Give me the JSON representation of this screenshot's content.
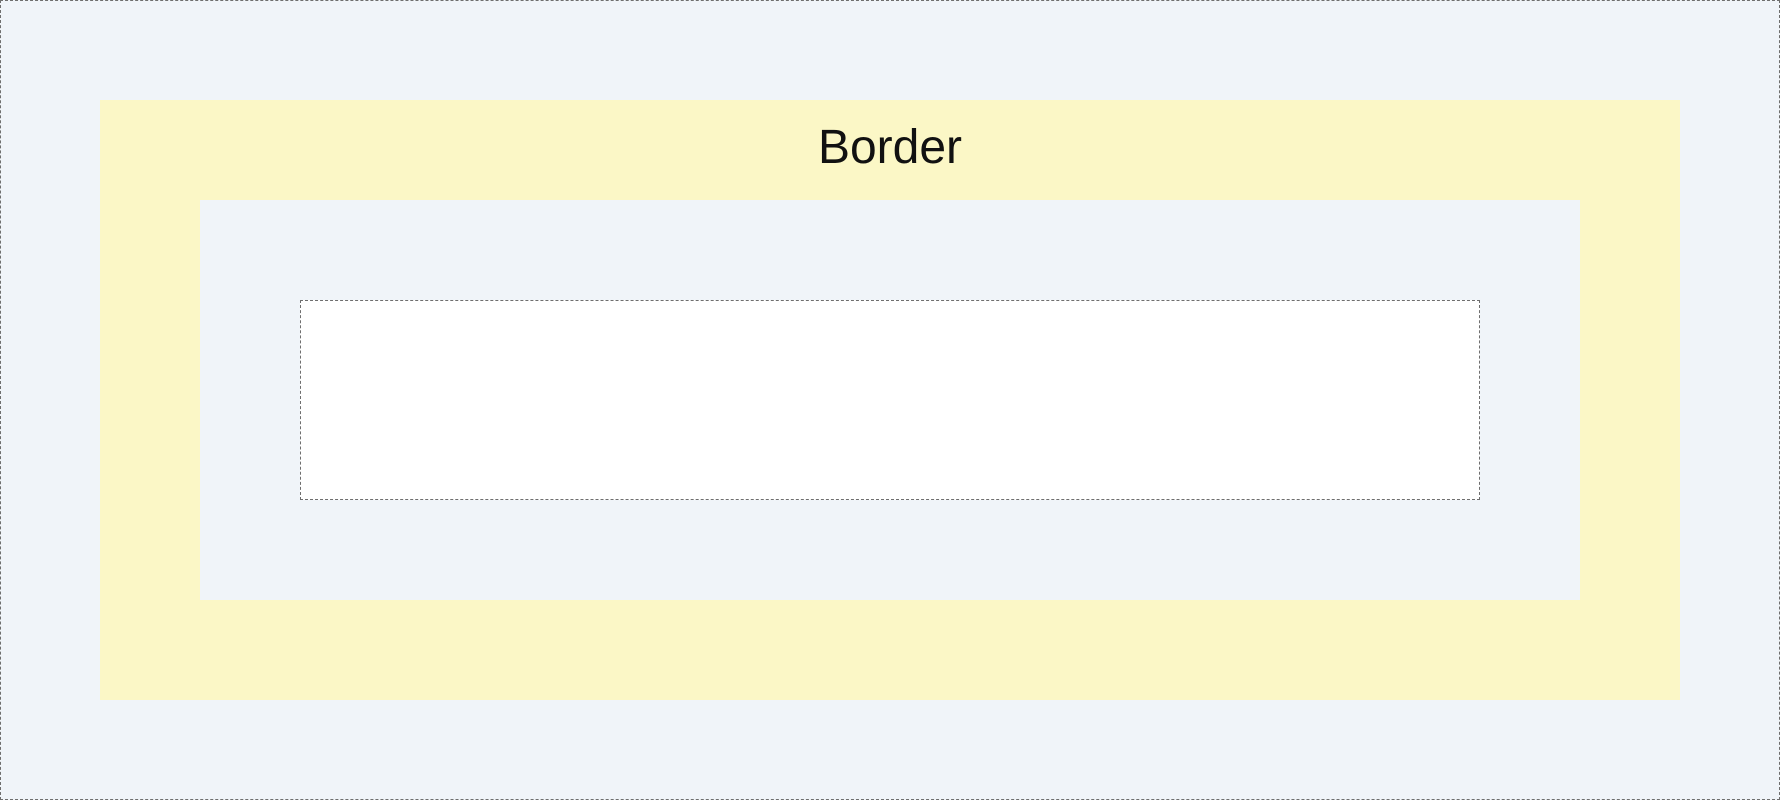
{
  "diagram": {
    "border_label": "Border"
  },
  "colors": {
    "margin_area": "#f0f4f9",
    "border_area": "#fbf7c6",
    "padding_area": "#f0f4f9",
    "content_area": "#ffffff",
    "dashed_outline": "#6e6e6e",
    "label_text": "#111111"
  }
}
